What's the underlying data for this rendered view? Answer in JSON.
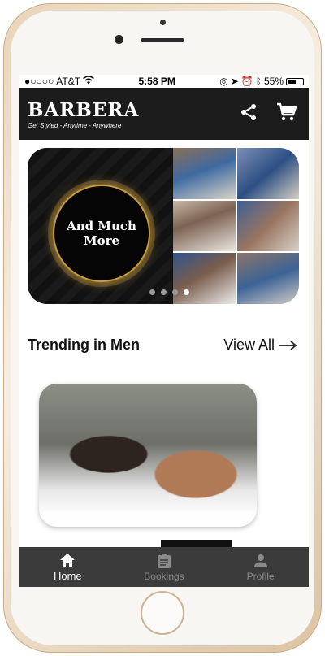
{
  "status_bar": {
    "carrier": "AT&T",
    "time": "5:58 PM",
    "battery": "55%",
    "battery_level": 0.55
  },
  "app_bar": {
    "logo_title": "BARBERA",
    "logo_tagline": "Get Styled - Anytime - Anywhere",
    "actions": [
      {
        "name": "share-icon"
      },
      {
        "name": "cart-icon"
      }
    ]
  },
  "carousel": {
    "promo_text_line1": "And Much",
    "promo_text_line2": "More",
    "page_count": 4,
    "active_index": 3
  },
  "trending": {
    "title": "Trending in Men",
    "view_all": "View All"
  },
  "bottom_nav": {
    "items": [
      {
        "label": "Home",
        "icon": "home-icon",
        "active": true
      },
      {
        "label": "Bookings",
        "icon": "clipboard-icon",
        "active": false
      },
      {
        "label": "Profile",
        "icon": "person-icon",
        "active": false
      }
    ]
  }
}
